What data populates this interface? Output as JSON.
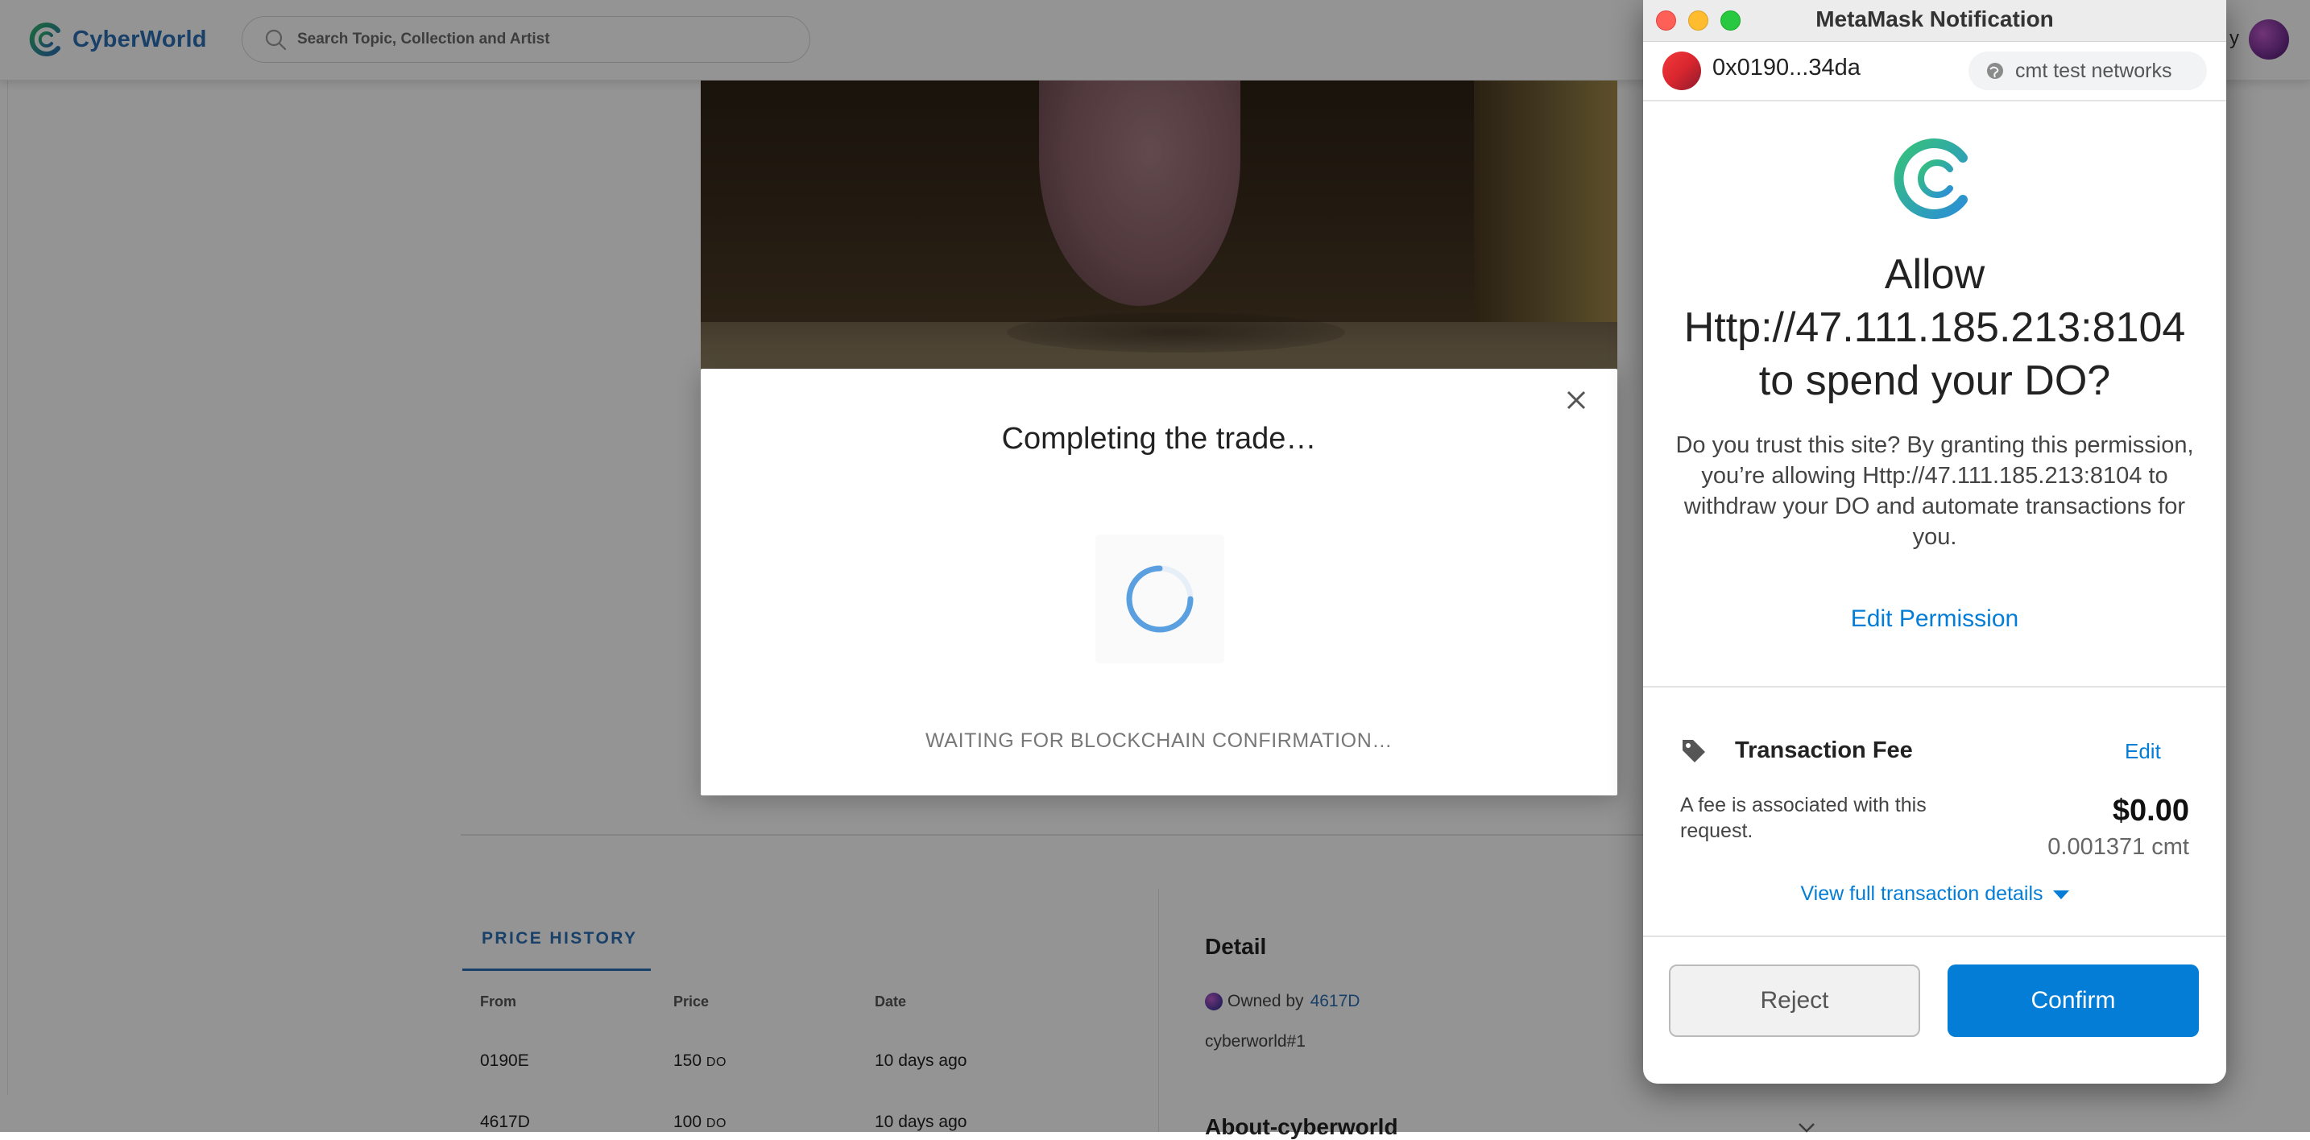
{
  "site": {
    "name": "CyberWorld",
    "search_placeholder": "Search Topic, Collection and Artist",
    "topbar_fragment": "y"
  },
  "trade_modal": {
    "title": "Completing the trade…",
    "status": "WAITING FOR BLOCKCHAIN CONFIRMATION…"
  },
  "price_history": {
    "tab_label": "PRICE HISTORY",
    "columns": [
      "From",
      "Price",
      "Date"
    ],
    "rows": [
      {
        "from": "0190E",
        "price": "150",
        "unit": "DO",
        "date": "10 days ago"
      },
      {
        "from": "4617D",
        "price": "100",
        "unit": "DO",
        "date": "10 days ago"
      }
    ]
  },
  "detail": {
    "title": "Detail",
    "owned_by_label": "Owned by",
    "owner": "4617D",
    "token": "cyberworld#1",
    "about_title": "About-cyberworld"
  },
  "metamask": {
    "window_title": "MetaMask Notification",
    "account": "0x0190...34da",
    "network": "cmt test networks",
    "heading": "Allow Http://47.111.185.213:8104 to spend your DO?",
    "description": "Do you trust this site? By granting this permission, you’re allowing Http://47.111.185.213:8104 to withdraw your DO and automate transactions for you.",
    "edit_permission": "Edit Permission",
    "fee": {
      "title": "Transaction Fee",
      "edit": "Edit",
      "note": "A fee is associated with this request.",
      "usd": "$0.00",
      "cmt": "0.001371 cmt",
      "view_details": "View full transaction details"
    },
    "buttons": {
      "reject": "Reject",
      "confirm": "Confirm"
    }
  },
  "colors": {
    "metamask_blue": "#037dd6",
    "cyberworld_blue": "#2b6fb3",
    "dim_overlay": "rgba(0,0,0,0.42)"
  },
  "icons": [
    "cyberworld-logo-icon",
    "search-icon",
    "close-icon",
    "loading-spinner-icon",
    "network-icon",
    "tag-icon",
    "chevron-down-icon"
  ]
}
